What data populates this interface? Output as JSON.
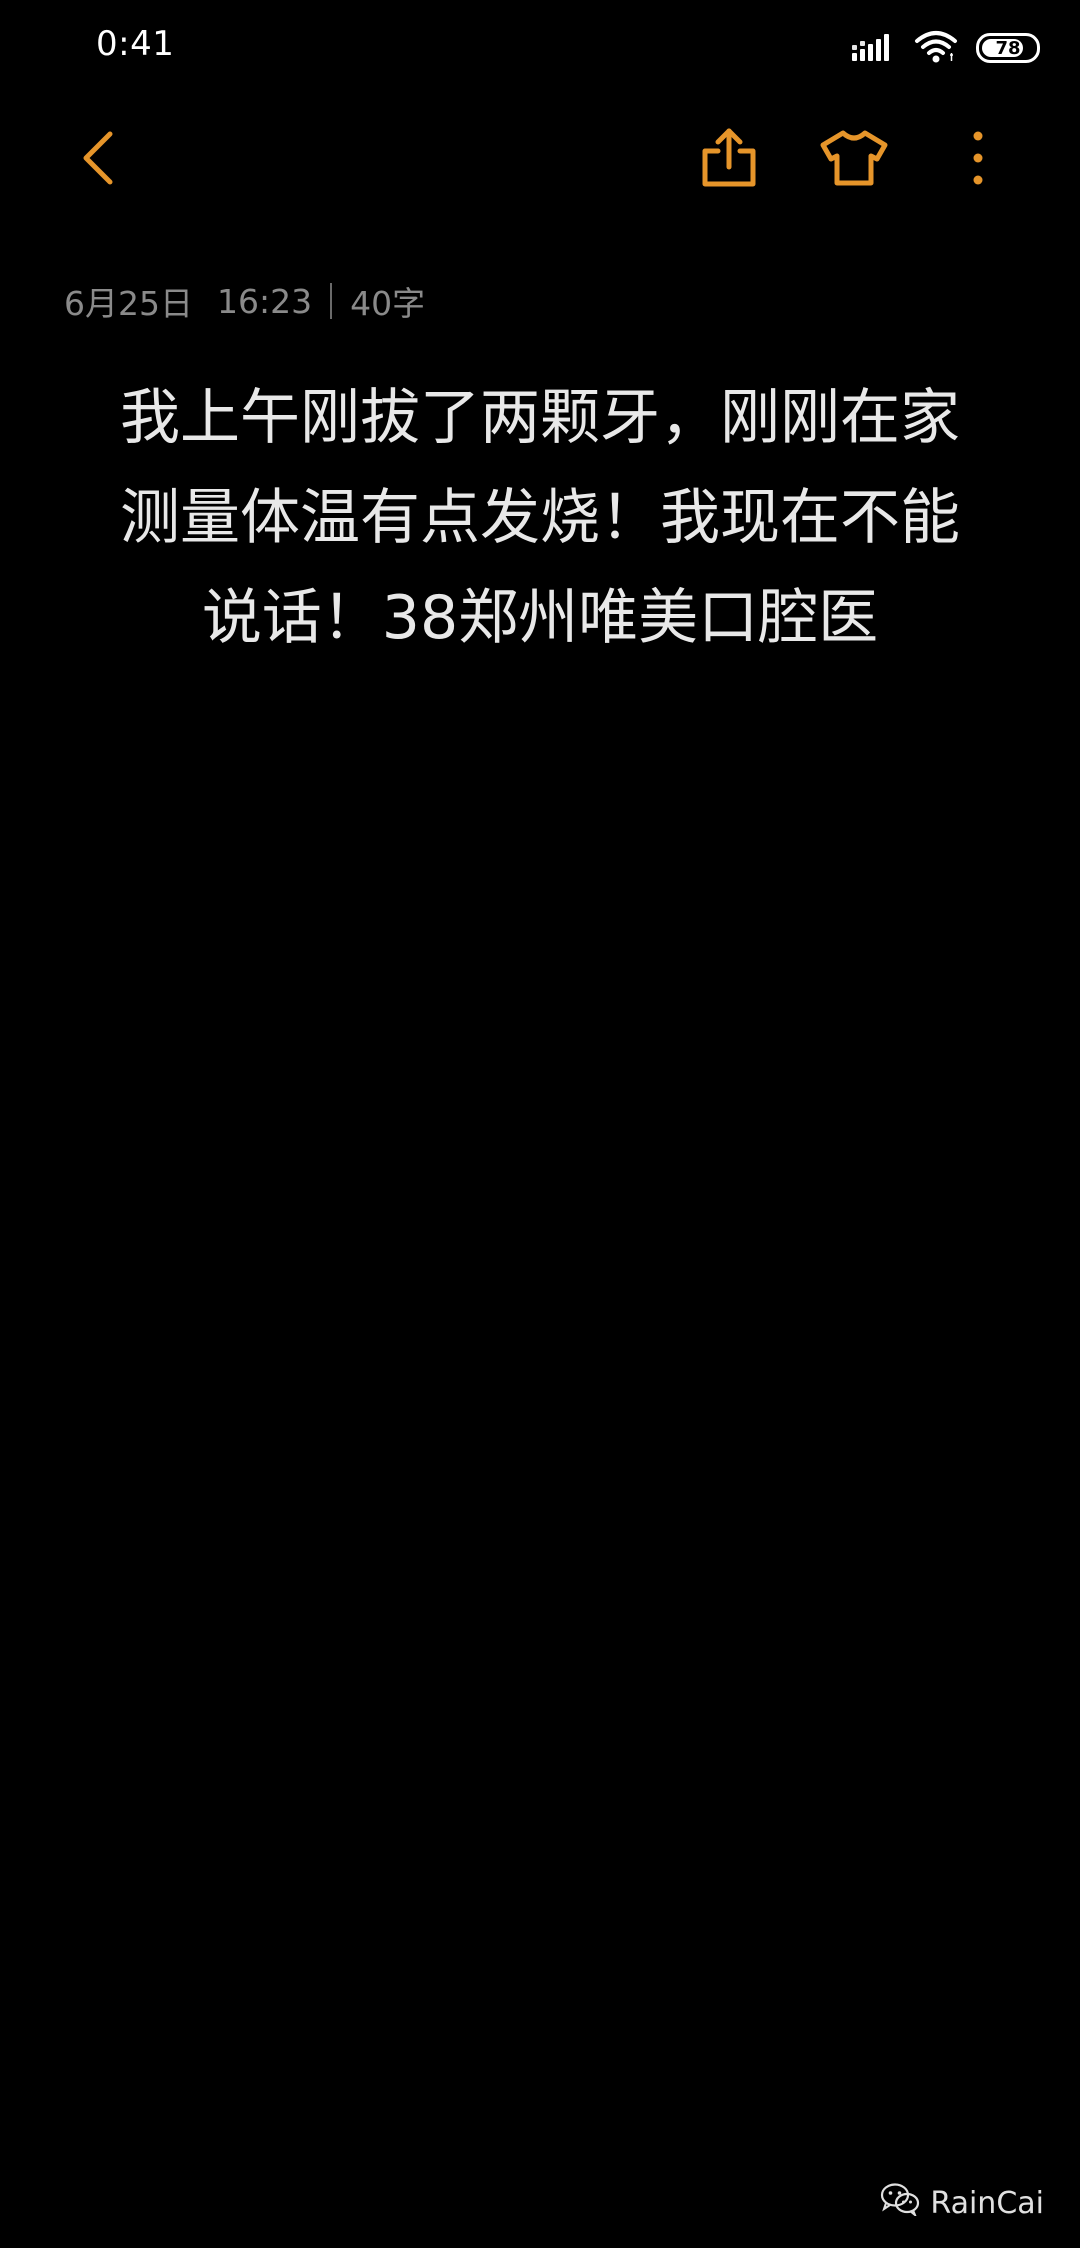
{
  "status_bar": {
    "time": "0:41",
    "battery": "78",
    "battery_level": 0.78,
    "icons": [
      "signal-icon",
      "wifi-icon",
      "battery-icon"
    ]
  },
  "toolbar": {
    "accent_color": "#E6952A",
    "icons": [
      "back-arrow-icon",
      "share-icon",
      "tshirt-theme-icon",
      "more-vertical-icon"
    ]
  },
  "note": {
    "date": "6月25日",
    "time": "16:23",
    "char_count": "40字",
    "content": "我上午刚拔了两颗牙，刚刚在家\n测量体温有点发烧！我现在不能\n说话！38郑州唯美口腔医"
  },
  "watermark": {
    "text": "RainCai",
    "icon": "wechat-icon"
  }
}
